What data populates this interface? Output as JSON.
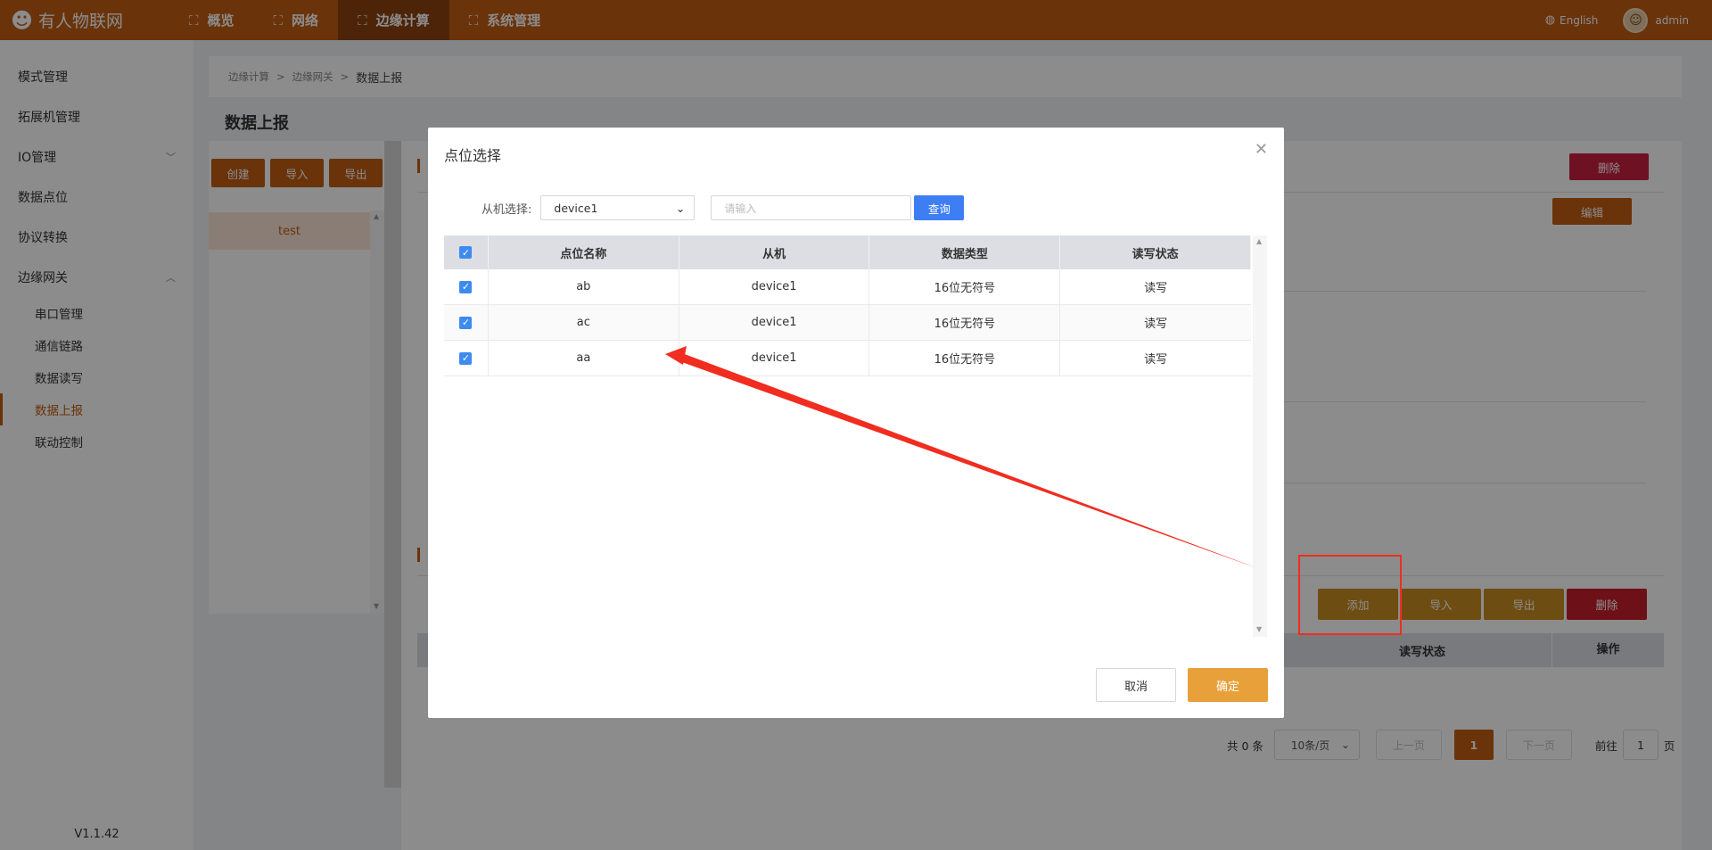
{
  "app": {
    "logo_text": "有人物联网",
    "nav": [
      {
        "label": "概览"
      },
      {
        "label": "网络"
      },
      {
        "label": "边缘计算"
      },
      {
        "label": "系统管理"
      }
    ],
    "language": "English",
    "user": "admin"
  },
  "sidebar": {
    "items": [
      {
        "label": "模式管理"
      },
      {
        "label": "拓展机管理"
      },
      {
        "label": "IO管理"
      },
      {
        "label": "数据点位"
      },
      {
        "label": "协议转换"
      },
      {
        "label": "边缘网关"
      }
    ],
    "sub_items": [
      {
        "label": "串口管理"
      },
      {
        "label": "通信链路"
      },
      {
        "label": "数据读写"
      },
      {
        "label": "数据上报"
      },
      {
        "label": "联动控制"
      }
    ],
    "version": "V1.1.42"
  },
  "breadcrumb": [
    "边缘计算",
    "边缘网关",
    "数据上报"
  ],
  "page_title": "数据上报",
  "left_panel": {
    "buttons": [
      "创建",
      "导入",
      "导出"
    ],
    "list": [
      "test"
    ]
  },
  "right_panel": {
    "delete_label": "删除",
    "edit_label": "编辑",
    "actions": [
      "添加",
      "导入",
      "导出",
      "删除"
    ],
    "table_headers": [
      "读写状态",
      "操作"
    ],
    "pager": {
      "total": "共 0 条",
      "page_size": "10条/页",
      "prev": "上一页",
      "page": "1",
      "next": "下一页",
      "goto_prefix": "前往",
      "goto_value": "1",
      "goto_suffix": "页"
    }
  },
  "modal": {
    "title": "点位选择",
    "filter_label": "从机选择:",
    "selected_slave": "device1",
    "search_placeholder": "请输入",
    "query_label": "查询",
    "headers": [
      "点位名称",
      "从机",
      "数据类型",
      "读写状态"
    ],
    "rows": [
      {
        "name": "ab",
        "slave": "device1",
        "type": "16位无符号",
        "rw": "读写"
      },
      {
        "name": "ac",
        "slave": "device1",
        "type": "16位无符号",
        "rw": "读写"
      },
      {
        "name": "aa",
        "slave": "device1",
        "type": "16位无符号",
        "rw": "读写"
      }
    ],
    "cancel_label": "取消",
    "ok_label": "确定"
  },
  "colors": {
    "brand": "#c25d13",
    "primary_blue": "#3e7ef5",
    "annotation_red": "#f02d20"
  },
  "icons": [
    "logo-icon",
    "nav-icon",
    "globe-icon",
    "avatar-icon",
    "chevron-down-icon",
    "chevron-up-icon",
    "close-icon",
    "check-icon"
  ]
}
